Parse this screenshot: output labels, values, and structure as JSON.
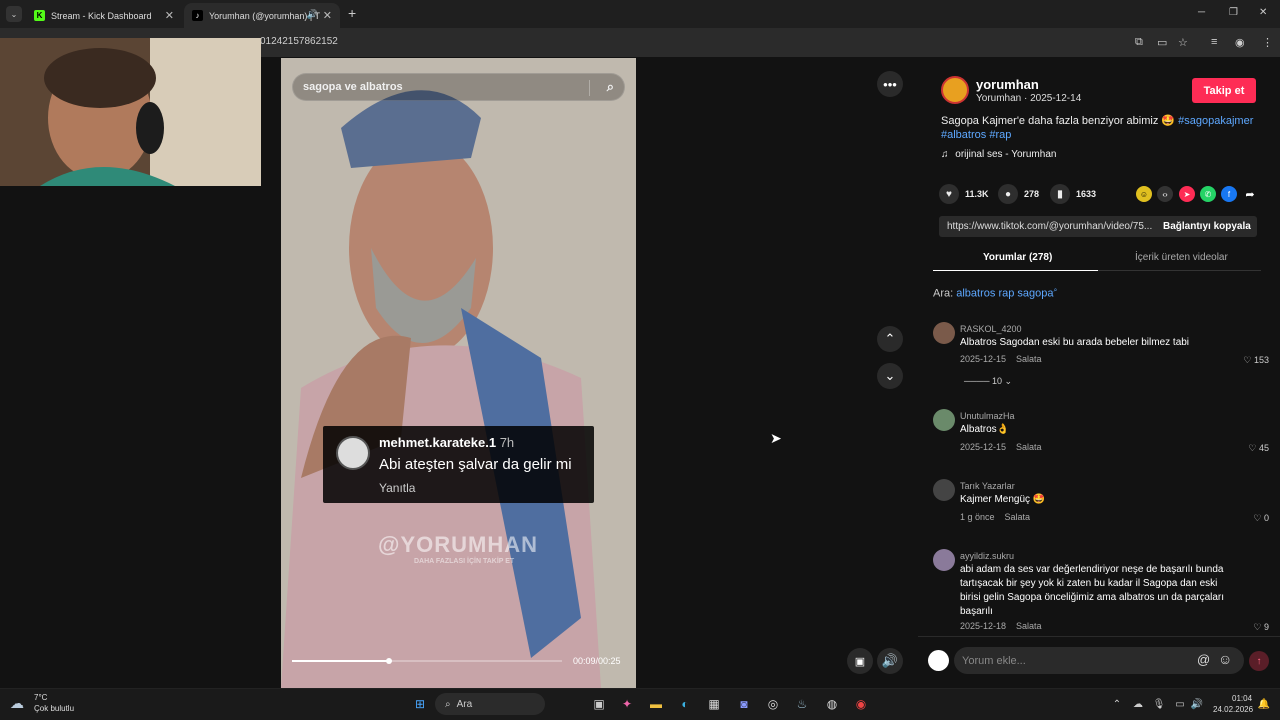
{
  "browser": {
    "tabs": [
      {
        "label": "Stream - Kick Dashboard",
        "active": false
      },
      {
        "label": "Yorumhan (@yorumhan) | T",
        "active": true
      }
    ],
    "new_tab": "+",
    "url": "01242157862152",
    "window_controls": {
      "min": "─",
      "max": "❐",
      "close": "✕"
    }
  },
  "video": {
    "search_placeholder": "sagopa ve albatros",
    "popup_comment": {
      "user": "mehmet.karateke.1",
      "age": "7h",
      "text": "Abi ateşten şalvar da gelir mi",
      "reply": "Yanıtla"
    },
    "watermark": "@YORUMHAN",
    "watermark_sub": "DAHA FAZLASI İÇİN TAKİP ET",
    "time": "00:09/00:25",
    "progress": 0.36
  },
  "post": {
    "user": "yorumhan",
    "subtitle": "Yorumhan · 2025-12-14",
    "follow_label": "Takip et",
    "description": "Sagopa Kajmer'e daha fazla benziyor abimiz 🤩",
    "hashtags": [
      "#sagopakajmer",
      "#albatros",
      "#rap"
    ],
    "music": "orijinal ses - Yorumhan",
    "stats": {
      "likes": "11.3K",
      "comments": "278",
      "saves": "1633"
    },
    "link": "https://www.tiktok.com/@yorumhan/video/75...",
    "copy_label": "Bağlantıyı kopyala",
    "tabs": [
      "Yorumlar (278)",
      "İçerik üreten videolar"
    ],
    "search_prefix": "Ara:",
    "search_suggestion": "albatros rap sagopa"
  },
  "comments": [
    {
      "user": "RASKOL_4200",
      "text": "Albatros Sagodan eski bu arada bebeler bilmez tabi",
      "date": "2025-12-15",
      "reply": "Salata",
      "likes": "153"
    },
    {
      "user": "UnutulmazHa",
      "text": "Albatros👌",
      "date": "2025-12-15",
      "reply": "Salata",
      "likes": "45"
    },
    {
      "user": "Tarık Yazarlar",
      "text": "Kajmer Mengüç 🤩",
      "date": "1 g önce",
      "reply": "Salata",
      "likes": "0"
    },
    {
      "user": "ayyildiz.sukru",
      "text": "abi adam da ses var değerlendiriyor neşe de başarılı bunda tartışacak bir şey yok ki zaten bu kadar il Sagopa dan eski birisi gelin Sagopa önceliğimiz ama albatros un da parçaları başarılı",
      "date": "2025-12-18",
      "reply": "Salata",
      "likes": "9"
    }
  ],
  "replies_toggle": "10",
  "input_placeholder": "Yorum ekle...",
  "taskbar": {
    "weather_temp": "7°C",
    "weather_desc": "Çok bulutlu",
    "search": "Ara",
    "time": "01:04",
    "date": "24.02.2026"
  }
}
